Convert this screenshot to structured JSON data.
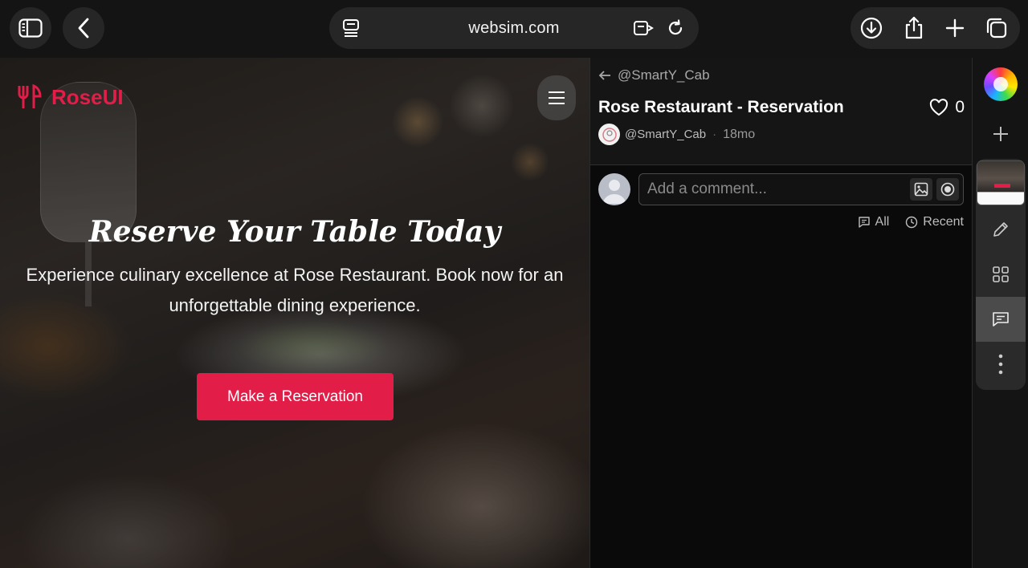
{
  "browser": {
    "url": "websim.com",
    "icons": {
      "sidebar": "sidebar-icon",
      "back": "chevron-left-icon",
      "page_menu": "page-menu-icon",
      "tab_switch": "tab-switch-icon",
      "reload": "reload-icon",
      "download": "download-icon",
      "share": "share-icon",
      "new_tab": "plus-icon",
      "tabs": "tabs-icon"
    }
  },
  "site": {
    "brand": "RoseUI",
    "hero_title": "Reserve Your Table Today",
    "hero_subtitle": "Experience culinary excellence at Rose Restaurant. Book now for an unforgettable dining experience.",
    "cta_label": "Make a Reservation",
    "accent": "#e11d48"
  },
  "panel": {
    "back_user": "@SmartY_Cab",
    "title": "Rose Restaurant - Reservation",
    "likes": "0",
    "author": "@SmartY_Cab",
    "age": "18mo",
    "comment_placeholder": "Add a comment...",
    "filters": {
      "all": "All",
      "recent": "Recent"
    }
  },
  "rail": {
    "items": [
      "logo",
      "new-project",
      "preview-thumbnail",
      "edit",
      "apps",
      "comments",
      "more"
    ],
    "active": "comments"
  }
}
